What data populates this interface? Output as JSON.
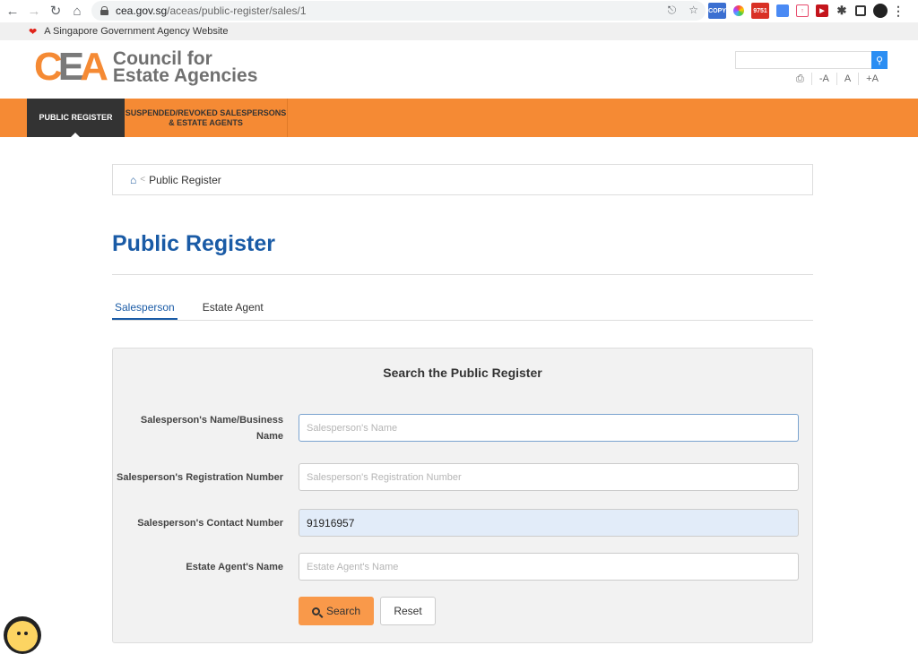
{
  "browser": {
    "url_host": "cea.gov.sg",
    "url_path": "/aceas/public-register/sales/1",
    "extensions": [
      {
        "name": "copy-extension",
        "label": "COPY",
        "color": "#3b6fd1"
      },
      {
        "name": "color-picker-extension",
        "label": "",
        "color": "#e6e6e6"
      },
      {
        "name": "gmail-extension",
        "label": "9751",
        "color": "#d93025"
      },
      {
        "name": "translate-extension",
        "label": "",
        "color": "#4a8af4"
      },
      {
        "name": "upload-extension",
        "label": "",
        "color": "#e74c6d"
      },
      {
        "name": "video-extension",
        "label": "",
        "color": "#c4151c"
      }
    ]
  },
  "gov_banner": {
    "text": "A Singapore Government Agency Website"
  },
  "header": {
    "logo_letters": [
      "C",
      "E",
      "A"
    ],
    "logo_line1": "Council for",
    "logo_line2": "Estate Agencies",
    "font_controls": [
      "-A",
      "A",
      "+A"
    ]
  },
  "nav": {
    "items": [
      {
        "label": "PUBLIC REGISTER",
        "active": true
      },
      {
        "label": "SUSPENDED/REVOKED SALESPERSONS & ESTATE AGENTS",
        "active": false
      }
    ]
  },
  "breadcrumb": {
    "current": "Public Register"
  },
  "page": {
    "title": "Public Register",
    "tabs": [
      {
        "label": "Salesperson",
        "active": true
      },
      {
        "label": "Estate Agent",
        "active": false
      }
    ]
  },
  "search": {
    "title": "Search the Public Register",
    "fields": [
      {
        "label": "Salesperson's Name/Business Name",
        "placeholder": "Salesperson's Name",
        "value": ""
      },
      {
        "label": "Salesperson's Registration Number",
        "placeholder": "Salesperson's Registration Number",
        "value": ""
      },
      {
        "label": "Salesperson's Contact Number",
        "placeholder": "",
        "value": "91916957"
      },
      {
        "label": "Estate Agent's Name",
        "placeholder": "Estate Agent's Name",
        "value": ""
      }
    ],
    "search_label": "Search",
    "reset_label": "Reset"
  },
  "colors": {
    "brand_orange": "#f58a34",
    "brand_blue": "#1a5ba6",
    "nav_active": "#333333"
  }
}
